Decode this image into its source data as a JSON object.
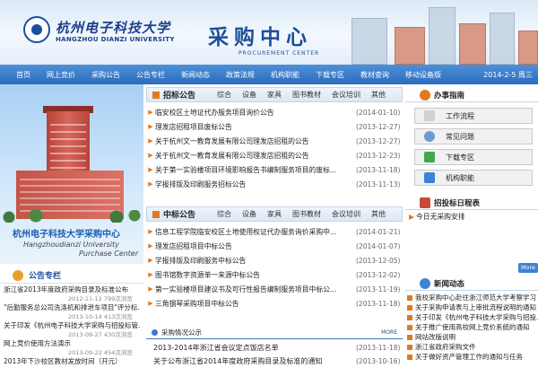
{
  "header": {
    "school_cn": "杭州电子科技大学",
    "school_en": "HANGZHOU DIANZI UNIVERSITY",
    "title_cn": "采购中心",
    "title_en": "PROCUREMENT CENTER"
  },
  "nav": {
    "items": [
      "首页",
      "网上竞价",
      "采购公告",
      "公告专栏",
      "新闻动态",
      "政策法规",
      "机构职能",
      "下载专区",
      "教材查询",
      "移动设备版"
    ],
    "date": "2014-2-5 周三"
  },
  "left": {
    "photo_title": "杭州电子科技大学采购中心",
    "photo_sub1": "Hangzhoudianzi University",
    "photo_sub2": "Purchase Center",
    "news_title": "公告专栏",
    "news": [
      {
        "title": "浙江省2013年度政府采购目录及标准公布",
        "date": "2012-11-12 799次浏览"
      },
      {
        "title": "\"后勤服务总公司洗涤机和排泄车项目\"评分标...",
        "date": "2013-10-14 413次浏览"
      },
      {
        "title": "关于印发《杭州电子科技大学采购与招投标管...",
        "date": "2013-09-27 430次浏览"
      },
      {
        "title": "网上竞价使用方法演示",
        "date": "2013-09-22 454次浏览"
      },
      {
        "title": "2013年下沙校区教材发放时间（开元）",
        "date": ""
      }
    ]
  },
  "bidding": {
    "title": "招标公告",
    "tabs": [
      "综合",
      "设备",
      "家具",
      "图书教材",
      "会议培训",
      "其他"
    ],
    "rows": [
      {
        "title": "临安校区土地证代办服务项目询价公告",
        "date": "(2014-01-10)"
      },
      {
        "title": "理发店招租项目废标公告",
        "date": "(2013-12-27)"
      },
      {
        "title": "关于杭州文一教育发展有限公司理发店招租的公告",
        "date": "(2013-12-27)"
      },
      {
        "title": "关于杭州文一教育发展有限公司理发店招租的公告",
        "date": "(2013-12-23)"
      },
      {
        "title": "关于第一实验楼项目环境影响报告书编制服务项目的废标...",
        "date": "(2013-11-18)"
      },
      {
        "title": "学报排版及印刷服务招标公告",
        "date": "(2013-11-13)"
      }
    ]
  },
  "award": {
    "title": "中标公告",
    "tabs": [
      "综合",
      "设备",
      "家具",
      "图书教材",
      "会议培训",
      "其他"
    ],
    "rows": [
      {
        "title": "信息工程学院临安校区土地使用权证代办服务询价采购中...",
        "date": "(2014-01-21)"
      },
      {
        "title": "理发店招租项目中标公告",
        "date": "(2014-01-07)"
      },
      {
        "title": "学报排版及印刷服务中标公告",
        "date": "(2013-12-05)"
      },
      {
        "title": "图书馆数字资源单一来源中标公告",
        "date": "(2013-12-02)"
      },
      {
        "title": "第一实验楼项目建议书及可行性报告编制服务项目中标公...",
        "date": "(2013-11-19)"
      },
      {
        "title": "三角钢琴采购项目中标公告",
        "date": "(2013-11-18)"
      }
    ]
  },
  "sub": {
    "title": "采购情况公示",
    "more": "MORE",
    "rows": [
      {
        "title": "2013-2014年浙江省会议定点饭店名单",
        "date": "(2013-11-18)"
      },
      {
        "title": "关于公布浙江省2014年度政府采购目录及标准的通知",
        "date": "(2013-10-16)"
      }
    ]
  },
  "right": {
    "guide_title": "办事指南",
    "guide_buttons": [
      "工作流程",
      "常见问题",
      "下载专区",
      "机构职能"
    ],
    "calendar_title": "招投标日程表",
    "calendar_item": "今日无采购安排",
    "more": "More",
    "news_title": "新闻动态",
    "news": [
      "我校采购中心赴往浙江师范大学考察学习",
      "关于采购申请表与上审批流程说明的通知",
      "关于印发《杭州电子科技大学采购与招投...",
      "关于推广使用高校网上竞价系统的通知",
      "网站改版说明",
      "浙江省政府采购文件",
      "关于做好资产管理工作的通知与任务"
    ]
  }
}
